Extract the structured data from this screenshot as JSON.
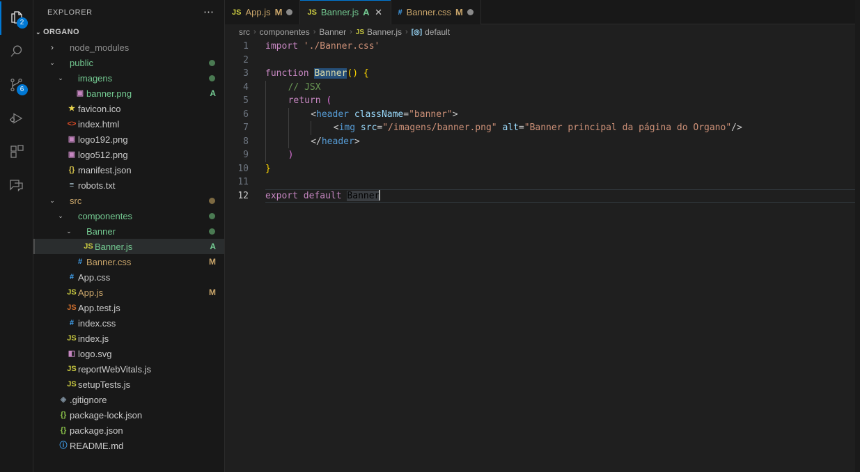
{
  "activitybar": {
    "items": [
      {
        "name": "explorer",
        "icon": "files-icon",
        "badge": "2",
        "active": true
      },
      {
        "name": "search",
        "icon": "search-icon",
        "badge": "",
        "active": false
      },
      {
        "name": "source-control",
        "icon": "source-control-icon",
        "badge": "6",
        "active": false
      },
      {
        "name": "run-and-debug",
        "icon": "run-debug-icon",
        "badge": "",
        "active": false
      },
      {
        "name": "extensions",
        "icon": "extensions-icon",
        "badge": "",
        "active": false
      },
      {
        "name": "chat",
        "icon": "chat-icon",
        "badge": "",
        "active": false
      }
    ]
  },
  "sidebar": {
    "title": "EXPLORER",
    "actions_label": "⋯",
    "root": {
      "label": "ORGANO",
      "twisty": "⌄"
    },
    "tree": [
      {
        "label": "node_modules",
        "indent": 1,
        "twisty": "›",
        "icon": "",
        "icon_color": "",
        "label_color": "#8c8c8c",
        "git": "",
        "git_color": "",
        "dot": "",
        "selected": false
      },
      {
        "label": "public",
        "indent": 1,
        "twisty": "⌄",
        "icon": "",
        "icon_color": "",
        "label_color": "#73c991",
        "git": "",
        "git_color": "",
        "dot": "#4a7a52",
        "selected": false
      },
      {
        "label": "imagens",
        "indent": 2,
        "twisty": "⌄",
        "icon": "",
        "icon_color": "",
        "label_color": "#73c991",
        "git": "",
        "git_color": "",
        "dot": "#4a7a52",
        "selected": false
      },
      {
        "label": "banner.png",
        "indent": 3,
        "twisty": "",
        "icon": "image-icon",
        "icon_color": "#c586c0",
        "label_color": "#73c991",
        "git": "A",
        "git_color": "#73c991",
        "dot": "",
        "selected": false
      },
      {
        "label": "favicon.ico",
        "indent": 2,
        "twisty": "",
        "icon": "star-icon",
        "icon_color": "#e8d44d",
        "label_color": "#cccccc",
        "git": "",
        "git_color": "",
        "dot": "",
        "selected": false
      },
      {
        "label": "index.html",
        "indent": 2,
        "twisty": "",
        "icon": "html-icon",
        "icon_color": "#e44d26",
        "label_color": "#cccccc",
        "git": "",
        "git_color": "",
        "dot": "",
        "selected": false
      },
      {
        "label": "logo192.png",
        "indent": 2,
        "twisty": "",
        "icon": "image-icon",
        "icon_color": "#c586c0",
        "label_color": "#cccccc",
        "git": "",
        "git_color": "",
        "dot": "",
        "selected": false
      },
      {
        "label": "logo512.png",
        "indent": 2,
        "twisty": "",
        "icon": "image-icon",
        "icon_color": "#c586c0",
        "label_color": "#cccccc",
        "git": "",
        "git_color": "",
        "dot": "",
        "selected": false
      },
      {
        "label": "manifest.json",
        "indent": 2,
        "twisty": "",
        "icon": "json-icon",
        "icon_color": "#d4c04a",
        "label_color": "#cccccc",
        "git": "",
        "git_color": "",
        "dot": "",
        "selected": false
      },
      {
        "label": "robots.txt",
        "indent": 2,
        "twisty": "",
        "icon": "text-icon",
        "icon_color": "#9fb8c4",
        "label_color": "#cccccc",
        "git": "",
        "git_color": "",
        "dot": "",
        "selected": false
      },
      {
        "label": "src",
        "indent": 1,
        "twisty": "⌄",
        "icon": "",
        "icon_color": "",
        "label_color": "#c9a56a",
        "git": "",
        "git_color": "",
        "dot": "#7d6a42",
        "selected": false
      },
      {
        "label": "componentes",
        "indent": 2,
        "twisty": "⌄",
        "icon": "",
        "icon_color": "",
        "label_color": "#73c991",
        "git": "",
        "git_color": "",
        "dot": "#4a7a52",
        "selected": false
      },
      {
        "label": "Banner",
        "indent": 3,
        "twisty": "⌄",
        "icon": "",
        "icon_color": "",
        "label_color": "#73c991",
        "git": "",
        "git_color": "",
        "dot": "#4a7a52",
        "selected": false
      },
      {
        "label": "Banner.js",
        "indent": 4,
        "twisty": "",
        "icon": "JS",
        "icon_color": "#cbcb41",
        "label_color": "#73c991",
        "git": "A",
        "git_color": "#73c991",
        "dot": "",
        "selected": true
      },
      {
        "label": "Banner.css",
        "indent": 3,
        "twisty": "",
        "icon": "#",
        "icon_color": "#42a5f5",
        "label_color": "#c9a56a",
        "git": "M",
        "git_color": "#c9a56a",
        "dot": "",
        "selected": false
      },
      {
        "label": "App.css",
        "indent": 2,
        "twisty": "",
        "icon": "#",
        "icon_color": "#42a5f5",
        "label_color": "#cccccc",
        "git": "",
        "git_color": "",
        "dot": "",
        "selected": false
      },
      {
        "label": "App.js",
        "indent": 2,
        "twisty": "",
        "icon": "JS",
        "icon_color": "#cbcb41",
        "label_color": "#c9a56a",
        "git": "M",
        "git_color": "#c9a56a",
        "dot": "",
        "selected": false
      },
      {
        "label": "App.test.js",
        "indent": 2,
        "twisty": "",
        "icon": "JS",
        "icon_color": "#cc6d2e",
        "label_color": "#cccccc",
        "git": "",
        "git_color": "",
        "dot": "",
        "selected": false
      },
      {
        "label": "index.css",
        "indent": 2,
        "twisty": "",
        "icon": "#",
        "icon_color": "#42a5f5",
        "label_color": "#cccccc",
        "git": "",
        "git_color": "",
        "dot": "",
        "selected": false
      },
      {
        "label": "index.js",
        "indent": 2,
        "twisty": "",
        "icon": "JS",
        "icon_color": "#cbcb41",
        "label_color": "#cccccc",
        "git": "",
        "git_color": "",
        "dot": "",
        "selected": false
      },
      {
        "label": "logo.svg",
        "indent": 2,
        "twisty": "",
        "icon": "svg-icon",
        "icon_color": "#c586c0",
        "label_color": "#cccccc",
        "git": "",
        "git_color": "",
        "dot": "",
        "selected": false
      },
      {
        "label": "reportWebVitals.js",
        "indent": 2,
        "twisty": "",
        "icon": "JS",
        "icon_color": "#cbcb41",
        "label_color": "#cccccc",
        "git": "",
        "git_color": "",
        "dot": "",
        "selected": false
      },
      {
        "label": "setupTests.js",
        "indent": 2,
        "twisty": "",
        "icon": "JS",
        "icon_color": "#cbcb41",
        "label_color": "#cccccc",
        "git": "",
        "git_color": "",
        "dot": "",
        "selected": false
      },
      {
        "label": ".gitignore",
        "indent": 1,
        "twisty": "",
        "icon": "git-icon",
        "icon_color": "#7a8b99",
        "label_color": "#cccccc",
        "git": "",
        "git_color": "",
        "dot": "",
        "selected": false
      },
      {
        "label": "package-lock.json",
        "indent": 1,
        "twisty": "",
        "icon": "json-icon",
        "icon_color": "#8bc34a",
        "label_color": "#cccccc",
        "git": "",
        "git_color": "",
        "dot": "",
        "selected": false
      },
      {
        "label": "package.json",
        "indent": 1,
        "twisty": "",
        "icon": "json-icon",
        "icon_color": "#8bc34a",
        "label_color": "#cccccc",
        "git": "",
        "git_color": "",
        "dot": "",
        "selected": false
      },
      {
        "label": "README.md",
        "indent": 1,
        "twisty": "",
        "icon": "info-icon",
        "icon_color": "#42a5f5",
        "label_color": "#cccccc",
        "git": "",
        "git_color": "",
        "dot": "",
        "selected": false
      }
    ]
  },
  "tabs": [
    {
      "icon": "JS",
      "icon_color": "#cbcb41",
      "label": "App.js",
      "label_color": "#c9a56a",
      "badge": "M",
      "badge_color": "#c9a56a",
      "dirty": true,
      "active": false,
      "closable": false
    },
    {
      "icon": "JS",
      "icon_color": "#cbcb41",
      "label": "Banner.js",
      "label_color": "#73c991",
      "badge": "A",
      "badge_color": "#73c991",
      "dirty": false,
      "active": true,
      "closable": true,
      "close_label": "✕"
    },
    {
      "icon": "#",
      "icon_color": "#42a5f5",
      "label": "Banner.css",
      "label_color": "#c9a56a",
      "badge": "M",
      "badge_color": "#c9a56a",
      "dirty": true,
      "active": false,
      "closable": false
    }
  ],
  "breadcrumb": {
    "separator": "›",
    "items": [
      {
        "label": "src",
        "icon": "",
        "icon_color": ""
      },
      {
        "label": "componentes",
        "icon": "",
        "icon_color": ""
      },
      {
        "label": "Banner",
        "icon": "",
        "icon_color": ""
      },
      {
        "label": "Banner.js",
        "icon": "JS",
        "icon_color": "#cbcb41"
      },
      {
        "label": "default",
        "icon": "[◎]",
        "icon_color": "#9cdcfe"
      }
    ]
  },
  "editor": {
    "language": "javascript",
    "current_line": 12,
    "cursor_column": 22,
    "selected_word": "Banner",
    "lines": [
      {
        "n": "1",
        "indents": 0,
        "text": "import './Banner.css'"
      },
      {
        "n": "2",
        "indents": 0,
        "text": ""
      },
      {
        "n": "3",
        "indents": 0,
        "text": "function Banner() {"
      },
      {
        "n": "4",
        "indents": 1,
        "text": "// JSX"
      },
      {
        "n": "5",
        "indents": 1,
        "text": "return ("
      },
      {
        "n": "6",
        "indents": 2,
        "text": "<header className=\"banner\">"
      },
      {
        "n": "7",
        "indents": 3,
        "text": "<img src=\"/imagens/banner.png\" alt=\"Banner principal da página do Organo\"/>"
      },
      {
        "n": "8",
        "indents": 2,
        "text": "</header>"
      },
      {
        "n": "9",
        "indents": 1,
        "text": ")"
      },
      {
        "n": "10",
        "indents": 0,
        "text": "}"
      },
      {
        "n": "11",
        "indents": 0,
        "text": ""
      },
      {
        "n": "12",
        "indents": 0,
        "text": "export default Banner"
      }
    ]
  },
  "colors": {
    "accent": "#0078d4",
    "editor_bg": "#1f1f1f",
    "sidebar_bg": "#181818",
    "added": "#73c991",
    "modified": "#c9a56a"
  }
}
